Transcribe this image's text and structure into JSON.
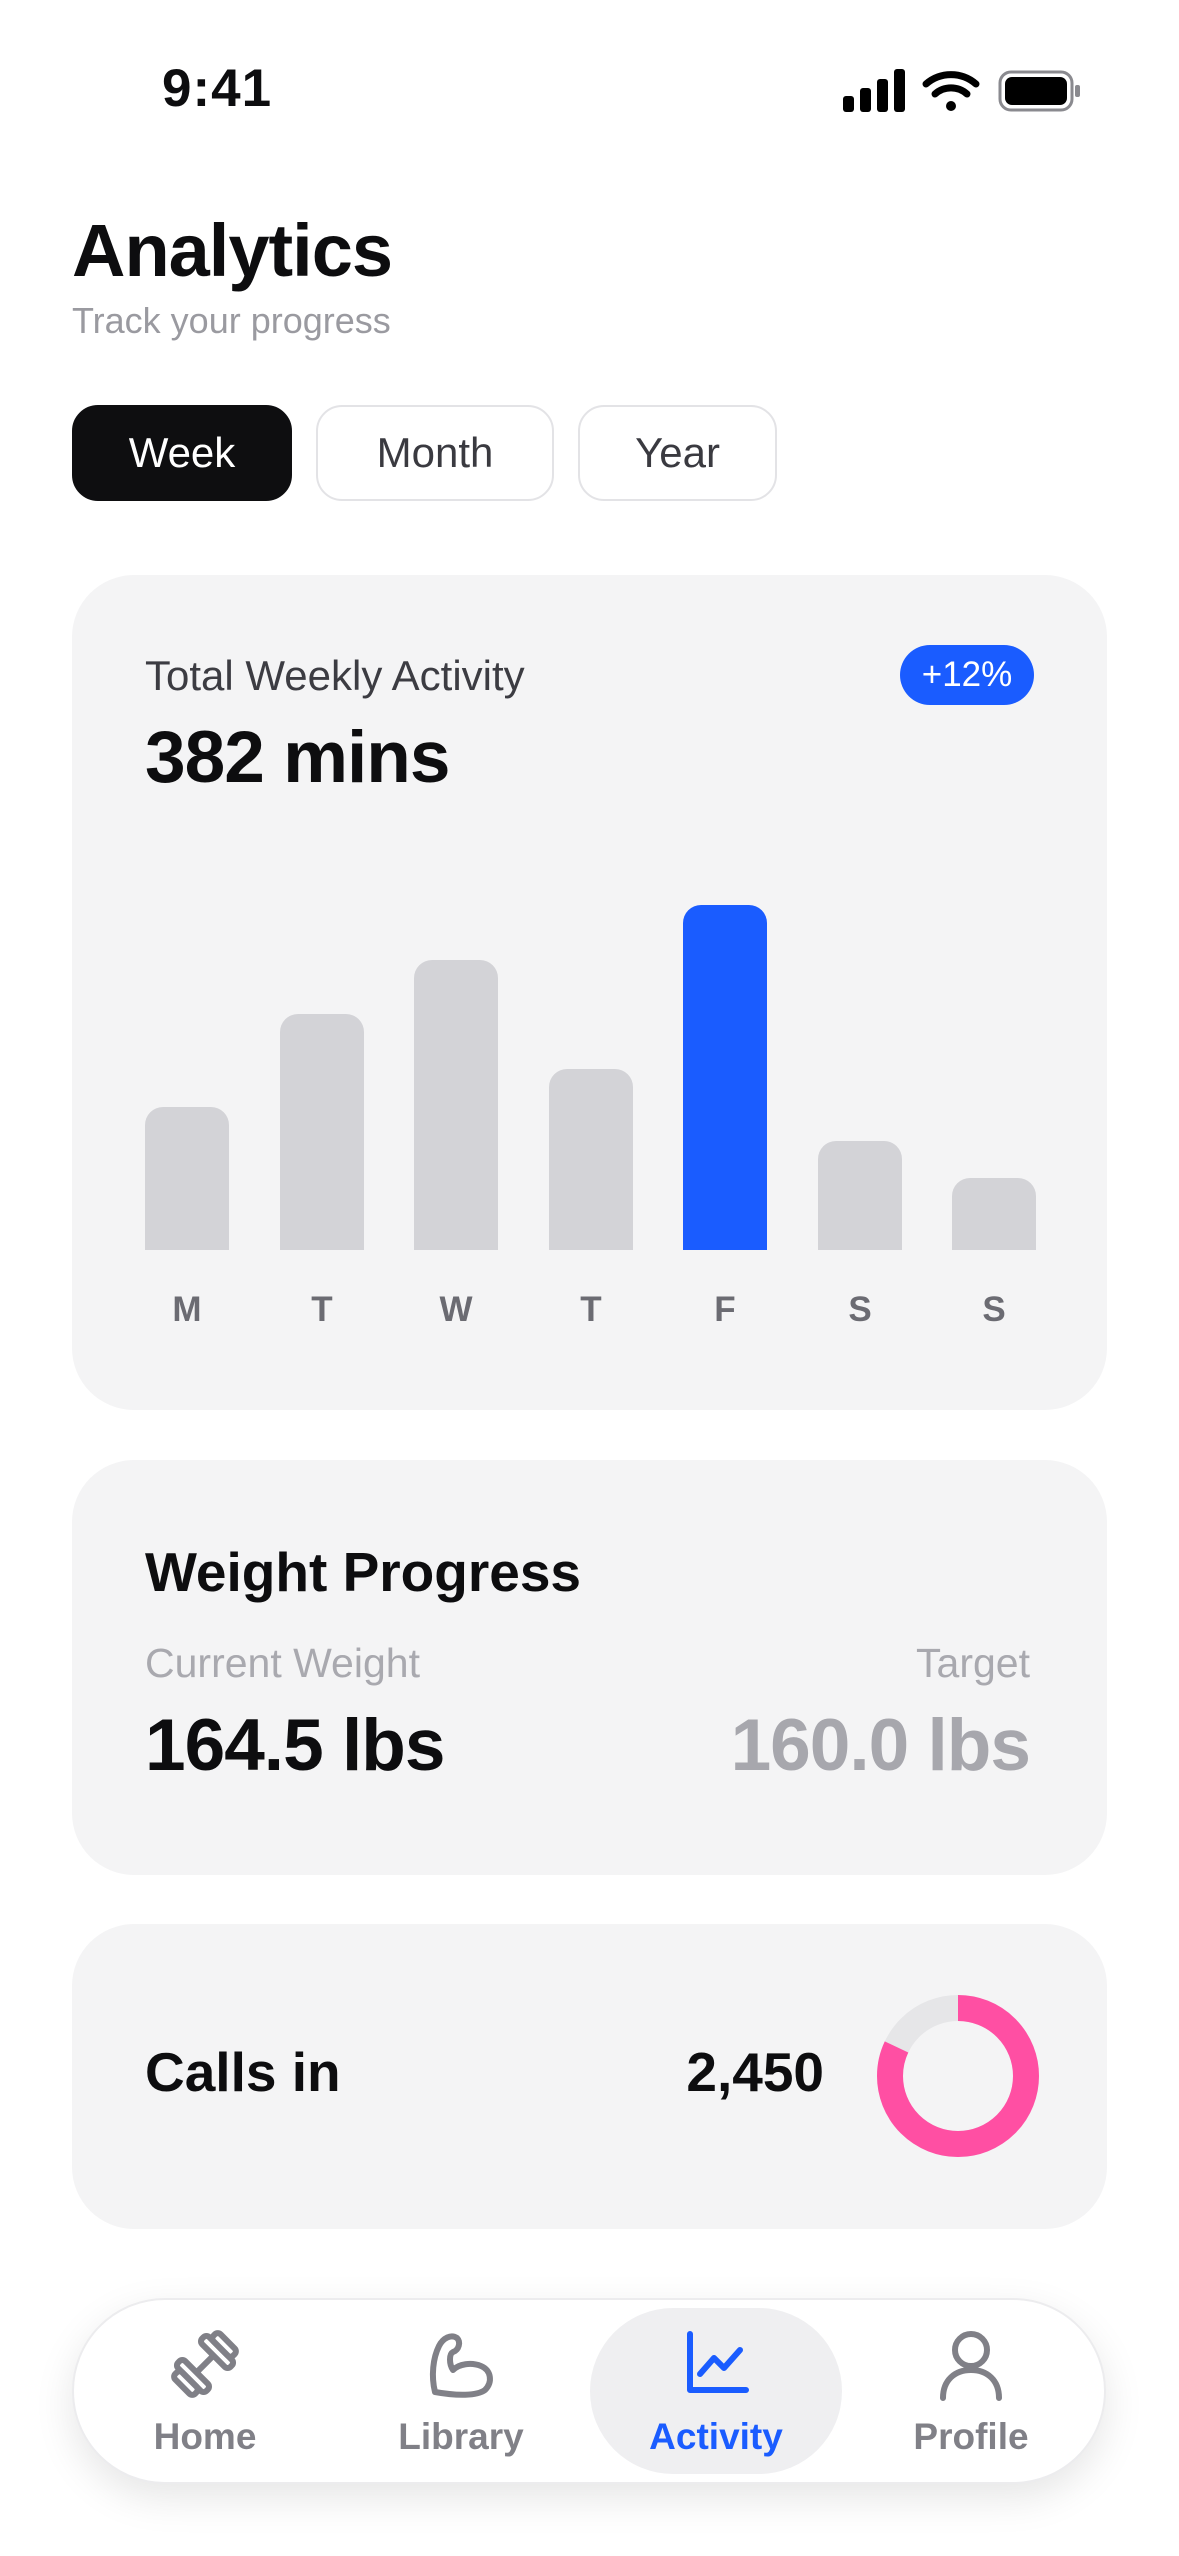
{
  "status_bar": {
    "time": "9:41",
    "icons": [
      "signal-icon",
      "wifi-icon",
      "battery-icon"
    ]
  },
  "header": {
    "title": "Analytics",
    "subtitle": "Track your progress"
  },
  "tabs": [
    {
      "label": "Week",
      "active": true
    },
    {
      "label": "Month",
      "active": false
    },
    {
      "label": "Year",
      "active": false
    }
  ],
  "activity_card": {
    "label": "Total Weekly Activity",
    "value": "382 mins",
    "badge": "+12%",
    "accent_color": "#1a5cff",
    "bar_color": "#d3d3d7"
  },
  "chart_data": {
    "type": "bar",
    "categories": [
      "M",
      "T",
      "W",
      "T",
      "F",
      "S",
      "S"
    ],
    "values": [
      42,
      69,
      85,
      53,
      101,
      32,
      21
    ],
    "highlighted_index": 4,
    "title": "",
    "xlabel": "",
    "ylabel": "",
    "grid": false
  },
  "weight_card": {
    "title": "Weight Progress",
    "current_label": "Current Weight",
    "current_value": "164.5 lbs",
    "target_label": "Target",
    "target_value": "160.0 lbs"
  },
  "calls_card": {
    "label": "Calls in",
    "value": "2,450",
    "ring_progress": 0.82,
    "ring_color": "#ff4fa3",
    "ring_track_color": "#e6e6e8"
  },
  "nav": {
    "items": [
      {
        "label": "Home",
        "icon": "dumbbell-icon",
        "active": false
      },
      {
        "label": "Library",
        "icon": "flexed-arm-icon",
        "active": false
      },
      {
        "label": "Activity",
        "icon": "chart-line-icon",
        "active": true
      },
      {
        "label": "Profile",
        "icon": "person-icon",
        "active": false
      }
    ]
  }
}
